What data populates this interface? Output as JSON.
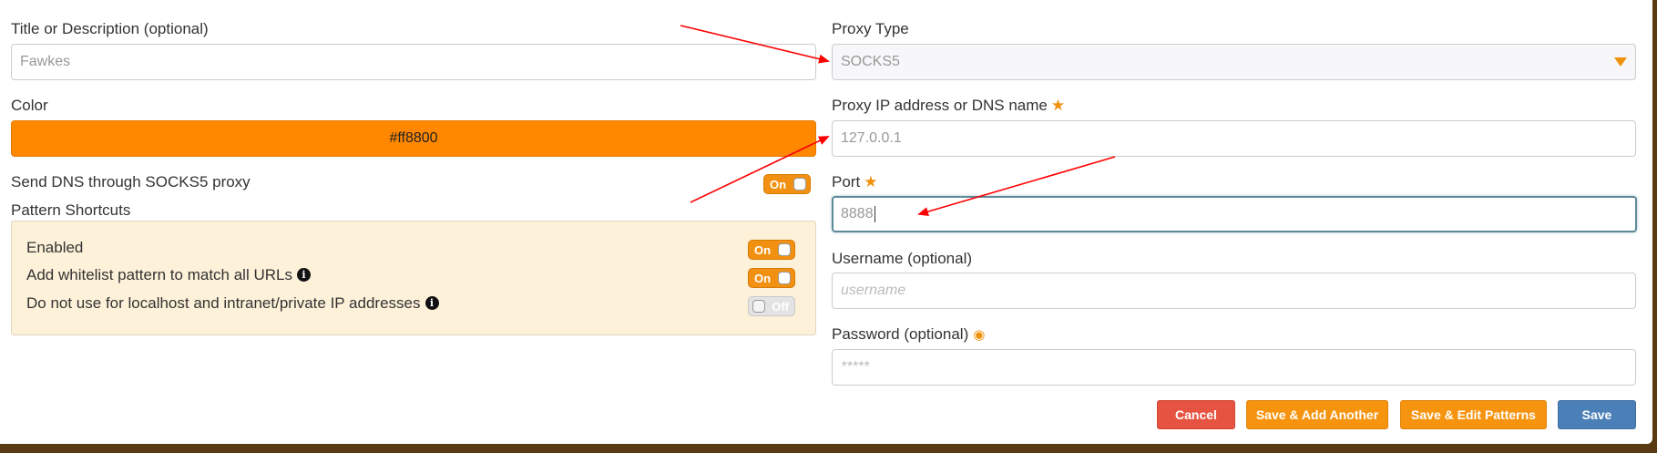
{
  "left": {
    "title_label": "Title or Description (optional)",
    "title_value": "Fawkes",
    "color_label": "Color",
    "color_value": "#ff8800",
    "dns_label": "Send DNS through SOCKS5 proxy",
    "dns_toggle": "On",
    "shortcuts_label": "Pattern Shortcuts",
    "shortcuts": {
      "enabled_label": "Enabled",
      "enabled_toggle": "On",
      "whitelist_label": "Add whitelist pattern to match all URLs",
      "whitelist_toggle": "On",
      "localhost_label": "Do not use for localhost and intranet/private IP addresses",
      "localhost_toggle": "Off"
    }
  },
  "right": {
    "proxy_type_label": "Proxy Type",
    "proxy_type_value": "SOCKS5",
    "ip_label": "Proxy IP address or DNS name",
    "ip_placeholder": "127.0.0.1",
    "port_label": "Port",
    "port_value": "8888",
    "username_label": "Username (optional)",
    "username_placeholder": "username",
    "password_label": "Password (optional)",
    "password_placeholder": "*****"
  },
  "buttons": {
    "cancel": "Cancel",
    "save_add": "Save & Add Another",
    "save_edit": "Save & Edit Patterns",
    "save": "Save"
  },
  "icons": {
    "required": "star-icon",
    "info": "info-icon",
    "show_password": "eye-icon",
    "dropdown": "caret-down-icon"
  },
  "colors": {
    "accent": "#f29111",
    "color_swatch": "#ff8800",
    "cancel": "#e65441",
    "save": "#4a7fb7",
    "annotation_arrow": "#ff0000"
  },
  "icon_glyphs": {
    "star": "★",
    "info": "i",
    "eye": "◉"
  }
}
